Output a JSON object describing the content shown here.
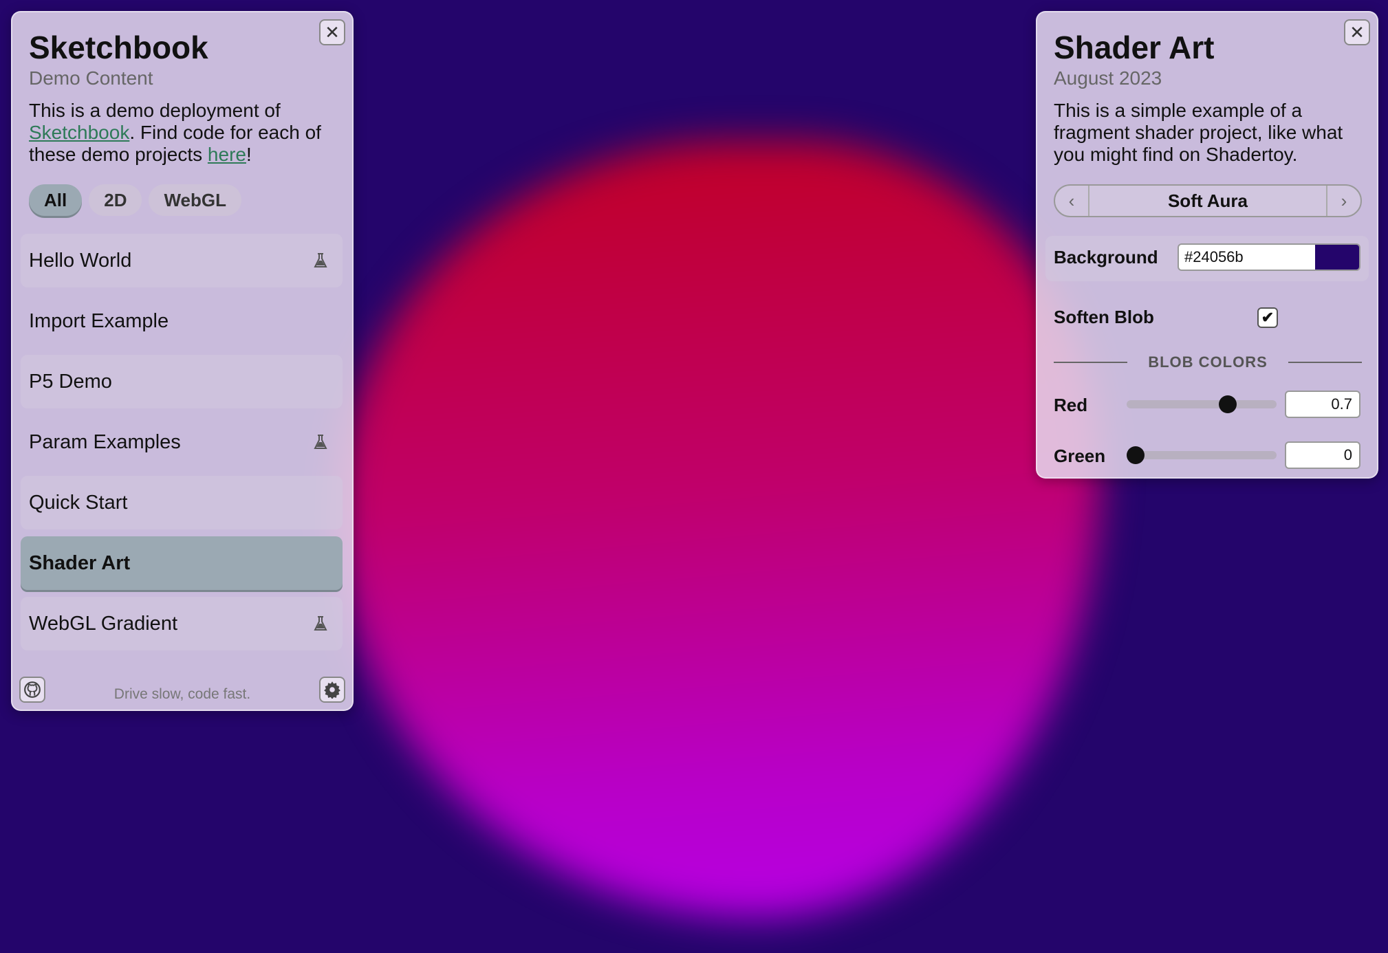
{
  "sidebar": {
    "title": "Sketchbook",
    "subtitle": "Demo Content",
    "desc": {
      "part1": "This is a demo deployment of ",
      "link1": "Sketchbook",
      "part2": ". Find code for each of these demo projects ",
      "link2": "here",
      "part3": "!"
    },
    "filters": [
      "All",
      "2D",
      "WebGL"
    ],
    "active_filter": "All",
    "items": [
      {
        "label": "Hello World",
        "experimental": true
      },
      {
        "label": "Import Example",
        "experimental": false
      },
      {
        "label": "P5 Demo",
        "experimental": false
      },
      {
        "label": "Param Examples",
        "experimental": true
      },
      {
        "label": "Quick Start",
        "experimental": false
      },
      {
        "label": "Shader Art",
        "experimental": false,
        "selected": true
      },
      {
        "label": "WebGL Gradient",
        "experimental": true
      }
    ],
    "footer": "Drive slow, code fast.",
    "icons": {
      "close": "close-icon",
      "github": "github-icon",
      "settings": "gear-icon",
      "experimental": "flask-icon"
    }
  },
  "params": {
    "title": "Shader Art",
    "subtitle": "August 2023",
    "desc": "This is a simple example of a fragment shader project, like what you might find on Shadertoy.",
    "preset": "Soft Aura",
    "background": {
      "label": "Background",
      "value": "#24056b"
    },
    "soften": {
      "label": "Soften Blob",
      "checked": true
    },
    "section": "BLOB COLORS",
    "sliders": [
      {
        "label": "Red",
        "value": 0.7,
        "display": "0.7"
      },
      {
        "label": "Green",
        "value": 0,
        "display": "0"
      }
    ]
  },
  "colors": {
    "background": "#24056b",
    "selected": "#9ba9b3",
    "link": "#2e7a58"
  }
}
